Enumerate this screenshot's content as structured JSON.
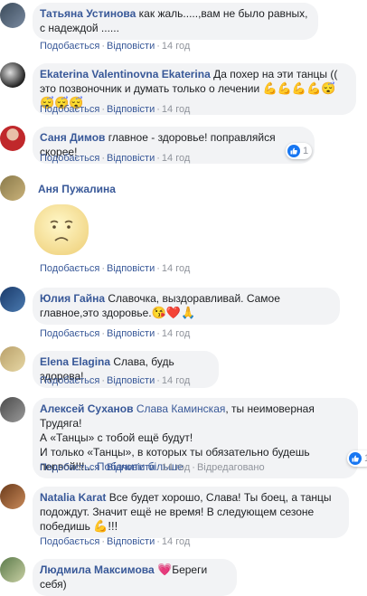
{
  "actions": {
    "like": "Подобається",
    "reply": "Відповісти",
    "edited": "Відредаговано"
  },
  "comments": [
    {
      "author": "Татьяна Устинова",
      "text": "как жаль.....,вам не было равных, с надеждой ......",
      "time": "14 год"
    },
    {
      "author": "Ekaterina Valentinovna Ekaterina",
      "text": "Да похер на эти танцы (( это позвоночник и думать только о лечении",
      "emoji": "💪💪💪💪😴😴😴😴",
      "time": "14 год"
    },
    {
      "author": "Саня Димов",
      "text": "главное - здоровье! поправляйся скорее!",
      "time": "14 год",
      "reaction_count": "1"
    },
    {
      "author": "Аня Пужалина",
      "time": "14 год",
      "sticker": "sad-face-sticker"
    },
    {
      "author": "Юлия Гайна",
      "text": "Славочка, выздоравливай. Самое главное,это здоровье.",
      "emoji": "😘❤️🙏",
      "time": "14 год"
    },
    {
      "author": "Elena Elagina",
      "text": "Слава, будь здорова!",
      "time": "14 год"
    },
    {
      "author": "Алексей Суханов",
      "tag": "Слава Каминская",
      "text_line1": ", ты неимоверная Трудяга!",
      "text_line2": "А «Танцы» с тобой ещё будут!",
      "text_line3": "И только «Танцы», в которых ты обязательно будешь",
      "text_line4": "первой!!!...",
      "more": "Побачити більше",
      "time": "14 год",
      "reaction_count": "1"
    },
    {
      "author": "Natalia Karat",
      "text": "Все будет хорошо, Слава! Ты боец, а танцы подождут. Значит ещё не время! В следующем сезоне победишь",
      "emoji": "💪!!!",
      "time": "14 год"
    },
    {
      "author": "Людмила Максимова",
      "emoji": "💗",
      "text": "Береги себя)"
    }
  ]
}
